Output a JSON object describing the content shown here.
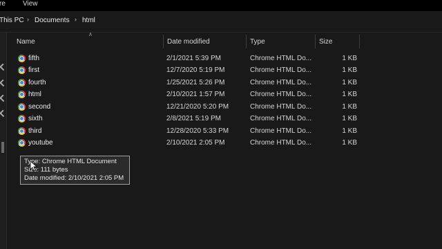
{
  "menu": {
    "items": [
      "re",
      "View"
    ]
  },
  "breadcrumb": {
    "items": [
      "This PC",
      "Documents",
      "html"
    ]
  },
  "columns": {
    "name": "Name",
    "date": "Date modified",
    "type": "Type",
    "size": "Size"
  },
  "files": [
    {
      "name": "fifth",
      "date": "2/1/2021 5:39 PM",
      "type": "Chrome HTML Do...",
      "size": "1 KB"
    },
    {
      "name": "first",
      "date": "12/7/2020 5:19 PM",
      "type": "Chrome HTML Do...",
      "size": "1 KB"
    },
    {
      "name": "fourth",
      "date": "1/25/2021 5:26 PM",
      "type": "Chrome HTML Do...",
      "size": "1 KB"
    },
    {
      "name": "html",
      "date": "2/10/2021 1:57 PM",
      "type": "Chrome HTML Do...",
      "size": "1 KB"
    },
    {
      "name": "second",
      "date": "12/21/2020 5:20 PM",
      "type": "Chrome HTML Do...",
      "size": "1 KB"
    },
    {
      "name": "sixth",
      "date": "2/8/2021 5:19 PM",
      "type": "Chrome HTML Do...",
      "size": "1 KB"
    },
    {
      "name": "third",
      "date": "12/28/2020 5:33 PM",
      "type": "Chrome HTML Do...",
      "size": "1 KB"
    },
    {
      "name": "youtube",
      "date": "2/10/2021 2:05 PM",
      "type": "Chrome HTML Do...",
      "size": "1 KB"
    }
  ],
  "tooltip": {
    "type": "Type: Chrome HTML Document",
    "size": "Size: 111 bytes",
    "date": "Date modified: 2/10/2021 2:05 PM"
  },
  "icons": {
    "file": "chrome-html-file-icon"
  }
}
